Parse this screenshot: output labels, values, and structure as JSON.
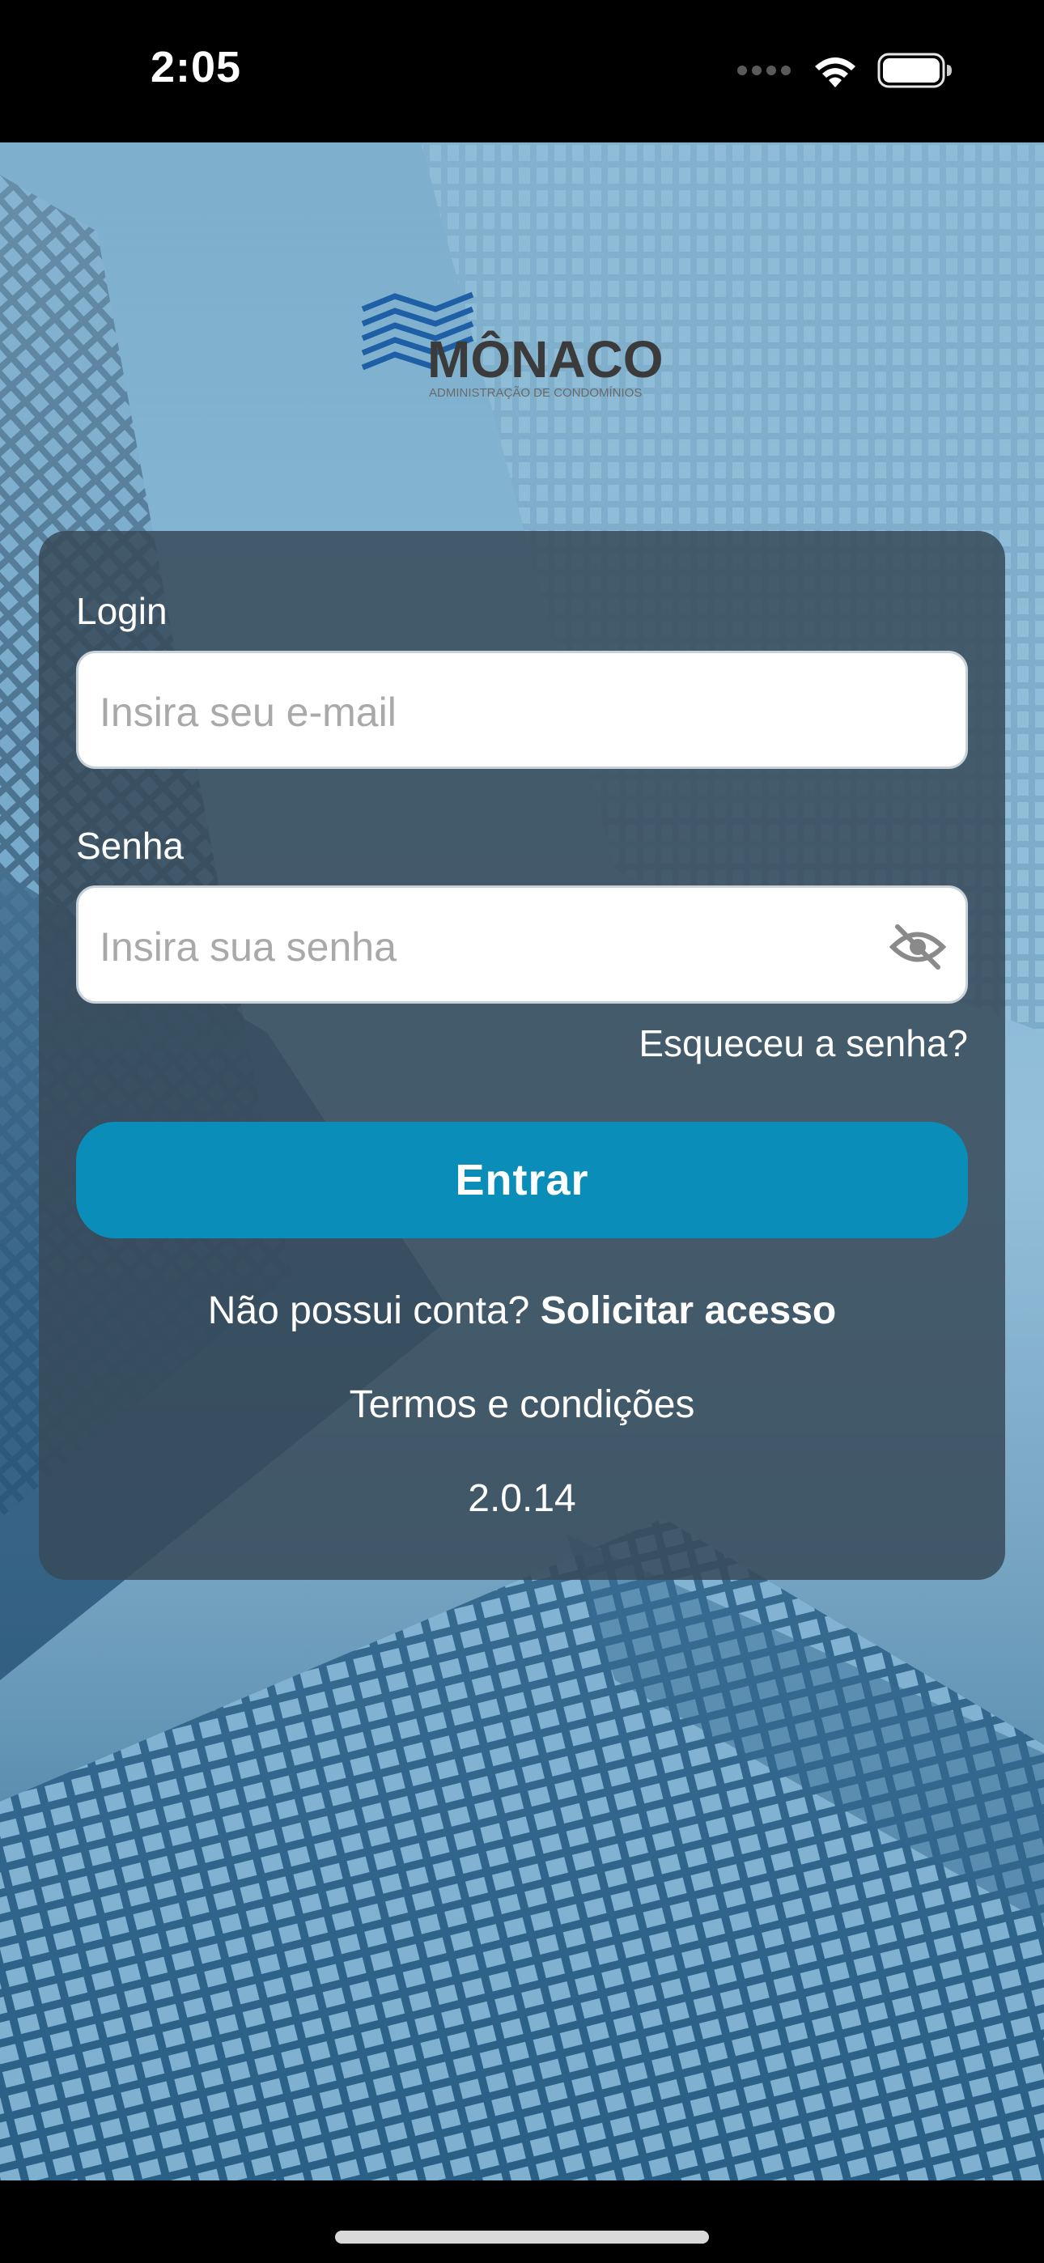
{
  "status_bar": {
    "time": "2:05",
    "icons": [
      "signal-dots-icon",
      "wifi-icon",
      "battery-icon"
    ]
  },
  "logo": {
    "name": "MÔNACO",
    "tagline": "ADMINISTRAÇÃO DE CONDOMÍNIOS"
  },
  "login_form": {
    "login_label": "Login",
    "login_placeholder": "Insira seu e-mail",
    "password_label": "Senha",
    "password_placeholder": "Insira sua senha",
    "password_toggle_icon": "eye-off-icon",
    "forgot_password": "Esqueceu a senha?",
    "submit_label": "Entrar",
    "no_account_text": "Não possui conta?",
    "request_access": "Solicitar acesso",
    "terms": "Termos e condições",
    "version": "2.0.14"
  },
  "colors": {
    "primary_button": "#0a8db8",
    "card_background": "#384a5a",
    "logo_blue": "#1f5fa6",
    "logo_dark": "#3b3b3b"
  }
}
